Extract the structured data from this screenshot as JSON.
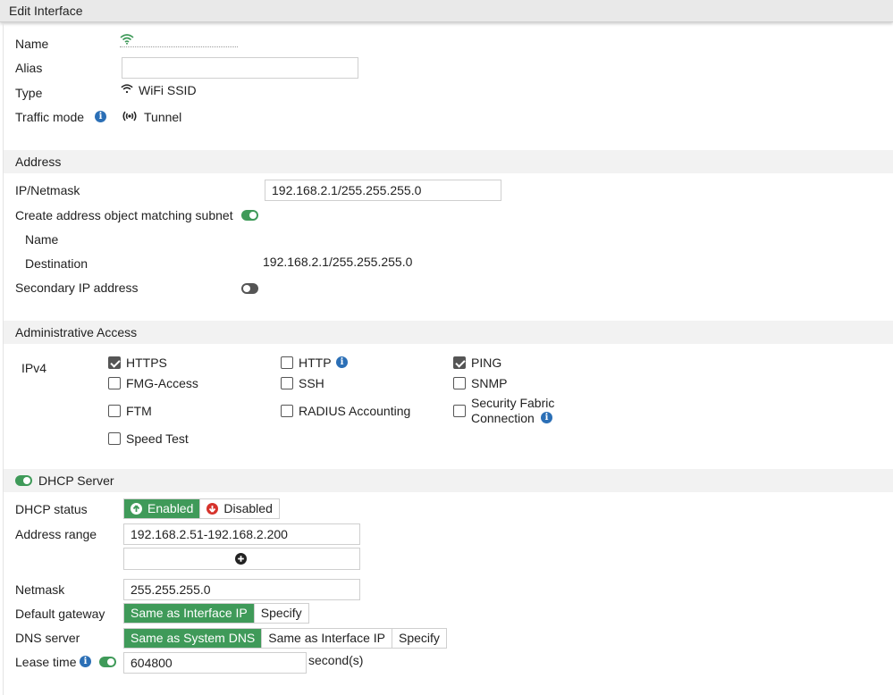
{
  "window": {
    "title": "Edit Interface"
  },
  "general": {
    "name_label": "Name",
    "alias_label": "Alias",
    "alias_value": "",
    "type_label": "Type",
    "type_value": "WiFi SSID",
    "traffic_label": "Traffic mode",
    "traffic_value": "Tunnel"
  },
  "address": {
    "section_title": "Address",
    "ip_label": "IP/Netmask",
    "ip_value": "192.168.2.1/255.255.255.0",
    "create_obj_label": "Create address object matching subnet",
    "create_obj_enabled": true,
    "obj_name_label": "Name",
    "destination_label": "Destination",
    "destination_value": "192.168.2.1/255.255.255.0",
    "secondary_label": "Secondary IP address",
    "secondary_enabled": false
  },
  "admin_access": {
    "section_title": "Administrative Access",
    "ipv4_label": "IPv4",
    "options": [
      {
        "label": "HTTPS",
        "checked": true
      },
      {
        "label": "HTTP",
        "checked": false
      },
      {
        "label": "PING",
        "checked": true
      },
      {
        "label": "FMG-Access",
        "checked": false
      },
      {
        "label": "SSH",
        "checked": false
      },
      {
        "label": "SNMP",
        "checked": false
      },
      {
        "label": "FTM",
        "checked": false
      },
      {
        "label": "RADIUS Accounting",
        "checked": false
      },
      {
        "label": "Security Fabric",
        "label2": "Connection",
        "checked": false
      },
      {
        "label": "Speed Test",
        "checked": false
      }
    ]
  },
  "dhcp": {
    "section_title": "DHCP Server",
    "enabled": true,
    "status_label": "DHCP status",
    "status_enabled": "Enabled",
    "status_disabled": "Disabled",
    "range_label": "Address range",
    "range_value": "192.168.2.51-192.168.2.200",
    "netmask_label": "Netmask",
    "netmask_value": "255.255.255.0",
    "gateway_label": "Default gateway",
    "gateway_opt1": "Same as Interface IP",
    "gateway_opt2": "Specify",
    "dns_label": "DNS server",
    "dns_opt1": "Same as System DNS",
    "dns_opt2": "Same as Interface IP",
    "dns_opt3": "Specify",
    "lease_label": "Lease time",
    "lease_value": "604800",
    "lease_unit": "second(s)"
  },
  "colors": {
    "accent_green": "#3f9a59",
    "info_blue": "#2b6fb6",
    "disabled_red": "#d6322b"
  }
}
